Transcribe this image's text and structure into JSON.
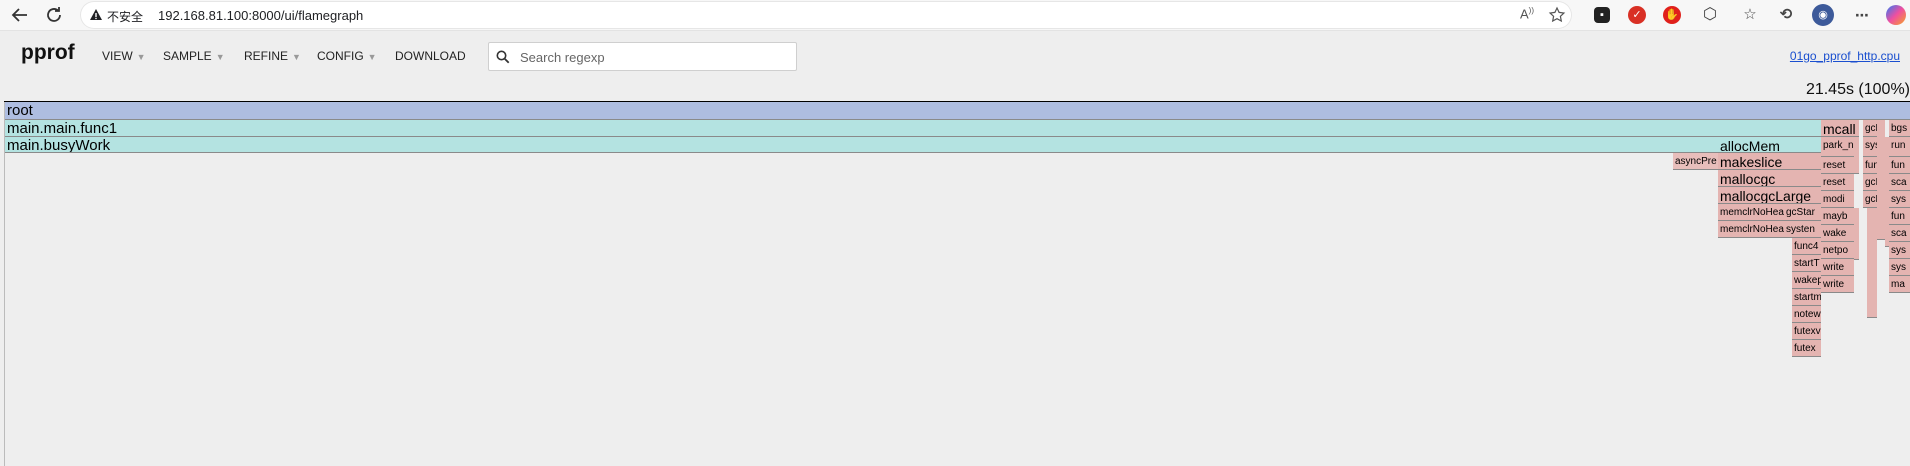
{
  "browser": {
    "security_label": "不安全",
    "url": "192.168.81.100:8000/ui/flamegraph",
    "read_aloud_label": "A"
  },
  "pprof": {
    "logo": "pprof",
    "menu": [
      {
        "label": "VIEW",
        "dropdown": true
      },
      {
        "label": "SAMPLE",
        "dropdown": true
      },
      {
        "label": "REFINE",
        "dropdown": true
      },
      {
        "label": "CONFIG",
        "dropdown": true
      },
      {
        "label": "DOWNLOAD",
        "dropdown": false
      }
    ],
    "search_placeholder": "Search regexp",
    "search_value": "",
    "profile_link": "01go_pprof_http.cpu",
    "total": "21.45s (100%)"
  },
  "flamegraph": {
    "frames": {
      "root": "root",
      "main_func1": "main.main.func1",
      "busywork": "main.busyWork",
      "asyncpre": "asyncPre",
      "allocmem": "allocMem",
      "makeslice": "makeslice",
      "mallocgc": "mallocgc",
      "mallocgclarge": "mallocgcLarge",
      "memclr1": "memclrNoHea",
      "memclr2": "memclrNoHea",
      "gcstart": "gcStar",
      "systemstack": "systen",
      "func4": "func4",
      "startt": "startT",
      "wakep": "wakep",
      "startm": "startm",
      "notewake": "notew",
      "futexwake": "futexv",
      "futex": "futex",
      "mcall": "mcall",
      "park_m": "park_n",
      "reset1": "reset",
      "reset2": "reset",
      "modi": "modi",
      "mayb": "mayb",
      "wake": "wake",
      "netpo": "netpo",
      "write1": "write",
      "write2": "write",
      "gcbg": "gcBg",
      "syst1": "syst",
      "func_gc": "func",
      "gcd1": "gcI",
      "gcd2": "gcD",
      "bgs": "bgs",
      "run": "run",
      "fun1": "fun",
      "sca1": "sca",
      "sys1": "sys",
      "fun2": "fun",
      "sca2": "sca",
      "sys2": "sys",
      "sys3": "sys",
      "ma": "ma"
    }
  }
}
